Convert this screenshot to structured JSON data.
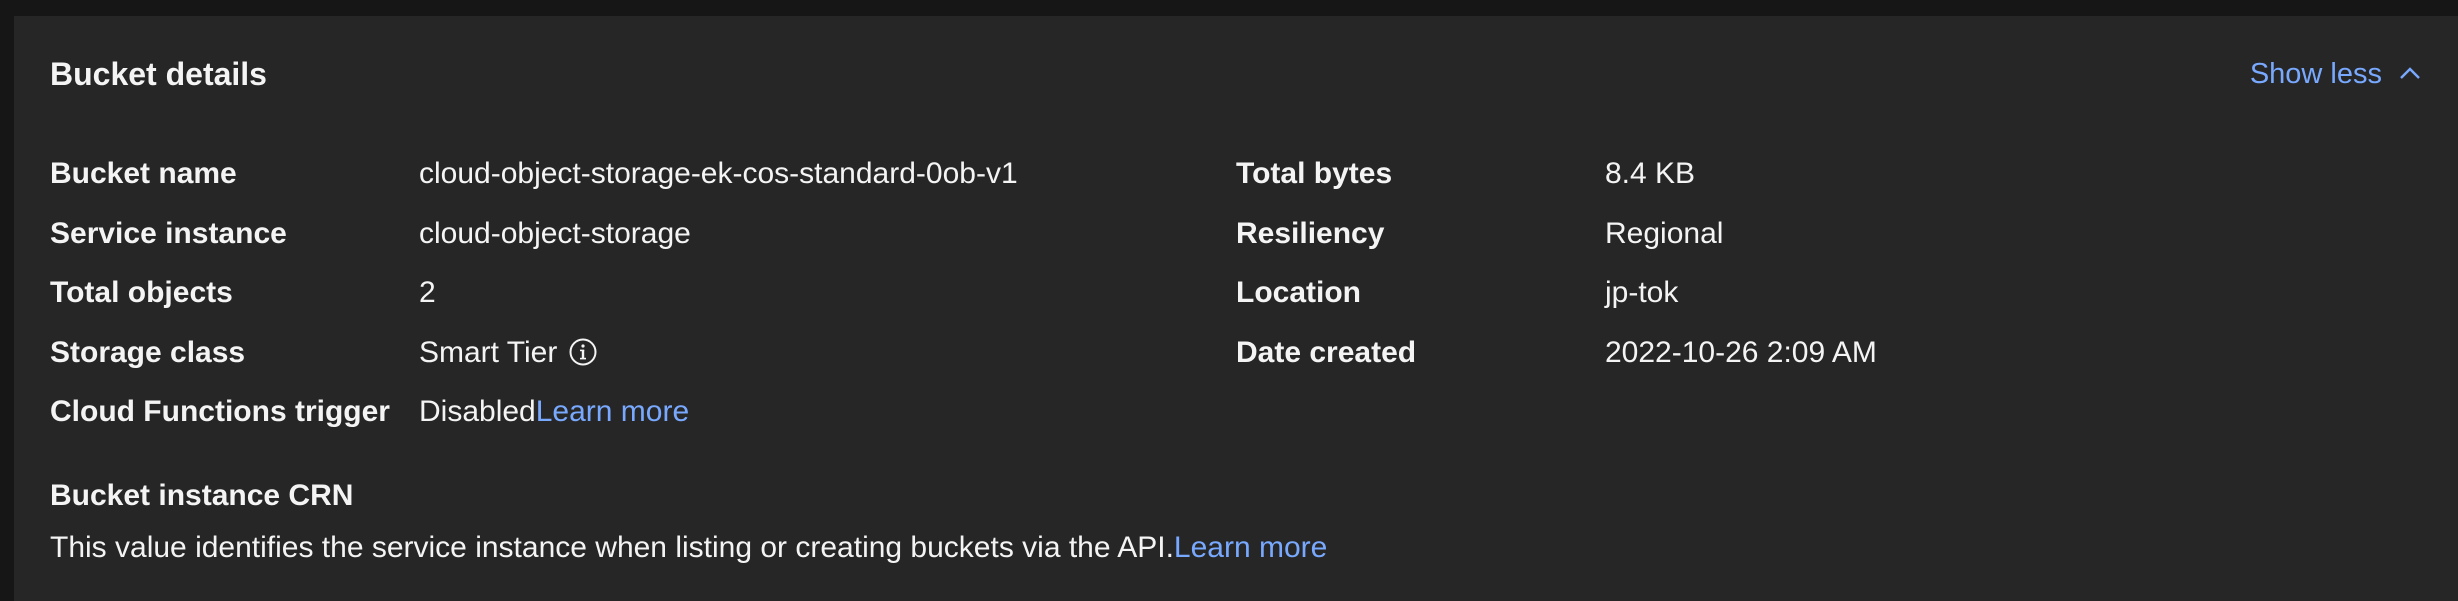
{
  "panel": {
    "title": "Bucket details",
    "toggle_label": "Show less",
    "toggle_icon": "chevron-up-icon"
  },
  "details_left": [
    {
      "label": "Bucket name",
      "value": "cloud-object-storage-ek-cos-standard-0ob-v1"
    },
    {
      "label": "Service instance",
      "value": "cloud-object-storage"
    },
    {
      "label": "Total objects",
      "value": "2"
    },
    {
      "label": "Storage class",
      "value": "Smart Tier",
      "icon": "info-icon"
    },
    {
      "label": "Cloud Functions trigger",
      "value": "Disabled",
      "link": "Learn more"
    }
  ],
  "details_right": [
    {
      "label": "Total bytes",
      "value": "8.4 KB"
    },
    {
      "label": "Resiliency",
      "value": "Regional"
    },
    {
      "label": "Location",
      "value": "jp-tok"
    },
    {
      "label": "Date created",
      "value": "2022-10-26 2:09 AM"
    }
  ],
  "crn": {
    "title": "Bucket instance CRN",
    "description": "This value identifies the service instance when listing or creating buckets via the API.",
    "link": "Learn more"
  },
  "colors": {
    "background": "#161616",
    "panel": "#262626",
    "text": "#f4f4f4",
    "link": "#78a9ff"
  }
}
